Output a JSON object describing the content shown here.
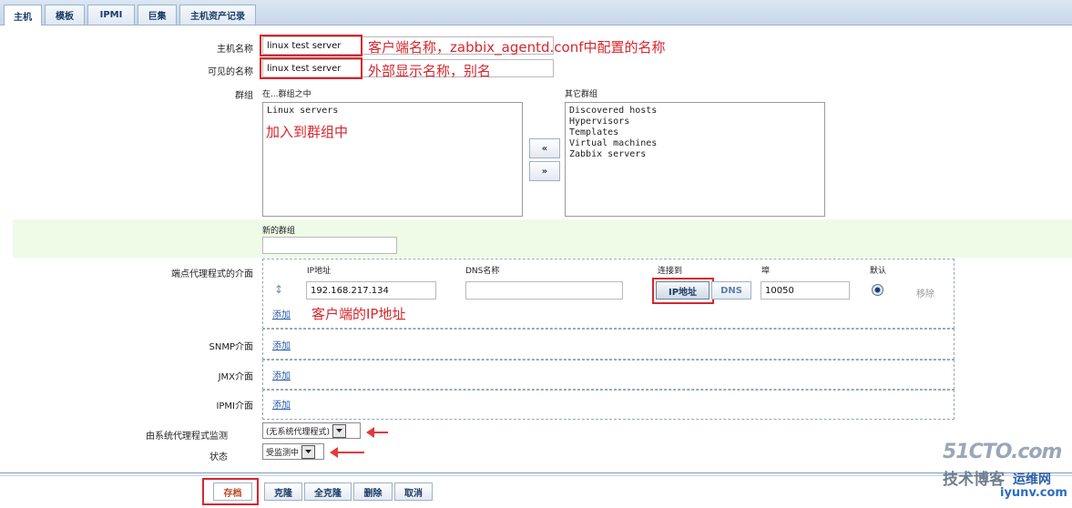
{
  "tabs": [
    "主机",
    "模板",
    "IPMI",
    "巨集",
    "主机资产记录"
  ],
  "form": {
    "host_name_label": "主机名称",
    "host_name_value": "linux test server",
    "host_name_note": "客户端名称，zabbix_agentd.conf中配置的名称",
    "visible_name_label": "可见的名称",
    "visible_name_value": "linux test server",
    "visible_name_note": "外部显示名称，别名",
    "groups_label": "群组",
    "in_groups_label": "在...群组之中",
    "other_groups_label": "其它群组",
    "in_groups": [
      "Linux servers"
    ],
    "in_groups_note": "加入到群组中",
    "other_groups": [
      "Discovered hosts",
      "Hypervisors",
      "Templates",
      "Virtual machines",
      "Zabbix servers"
    ],
    "move_left": "«",
    "move_right": "»",
    "new_group_label": "新的群组",
    "new_group_value": ""
  },
  "agent": {
    "label": "端点代理程式的介面",
    "col_ip": "IP地址",
    "col_dns": "DNS名称",
    "col_connect": "连接到",
    "col_port": "埠",
    "col_default": "默认",
    "ip_value": "192.168.217.134",
    "dns_value": "",
    "connect_ip": "IP地址",
    "connect_dns": "DNS",
    "port_value": "10050",
    "remove": "移除",
    "add": "添加",
    "ip_note": "客户端的IP地址"
  },
  "interfaces": {
    "snmp_label": "SNMP介面",
    "jmx_label": "JMX介面",
    "ipmi_label": "IPMI介面",
    "add": "添加"
  },
  "monitor": {
    "proxy_label": "由系统代理程式监测",
    "proxy_value": "(无系统代理程式)",
    "status_label": "状态",
    "status_value": "受监测中"
  },
  "buttons": {
    "save": "存档",
    "clone": "克隆",
    "full_clone": "全克隆",
    "delete": "删除",
    "cancel": "取消"
  },
  "watermark": {
    "site": "51CTO.com",
    "line2": "技术博客",
    "brand": "运维网",
    "url": "iyunv.com"
  },
  "colors": {
    "annotation": "#d7262d",
    "highlight_row": "#eefbe6",
    "link": "#2a5aa8"
  }
}
